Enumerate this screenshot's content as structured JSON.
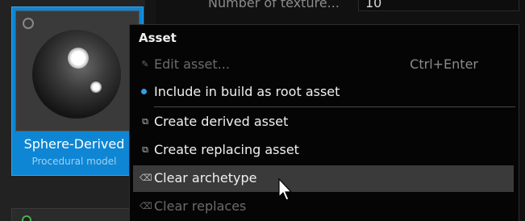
{
  "background": {
    "property_label": "Number of texture...",
    "property_value": "10"
  },
  "asset": {
    "name": "Sphere-Derived",
    "type": "Procedural model"
  },
  "menu": {
    "header": "Asset",
    "items": [
      {
        "label": "Edit asset...",
        "shortcut": "Ctrl+Enter",
        "icon": "pencil-icon",
        "enabled": false
      },
      {
        "label": "Include in build as root asset",
        "icon": "bullet-icon",
        "enabled": true
      },
      {
        "label": "Create derived asset",
        "icon": "copy-icon",
        "enabled": true
      },
      {
        "label": "Create replacing asset",
        "icon": "copy-icon",
        "enabled": true
      },
      {
        "label": "Clear archetype",
        "icon": "eraser-icon",
        "enabled": true,
        "hovered": true
      },
      {
        "label": "Clear replaces",
        "icon": "eraser-icon",
        "enabled": false
      }
    ]
  },
  "colors": {
    "accent": "#0e86d4",
    "menu_bg": "#050505",
    "hover": "#3a3a3a",
    "bullet": "#2fa0e6"
  }
}
